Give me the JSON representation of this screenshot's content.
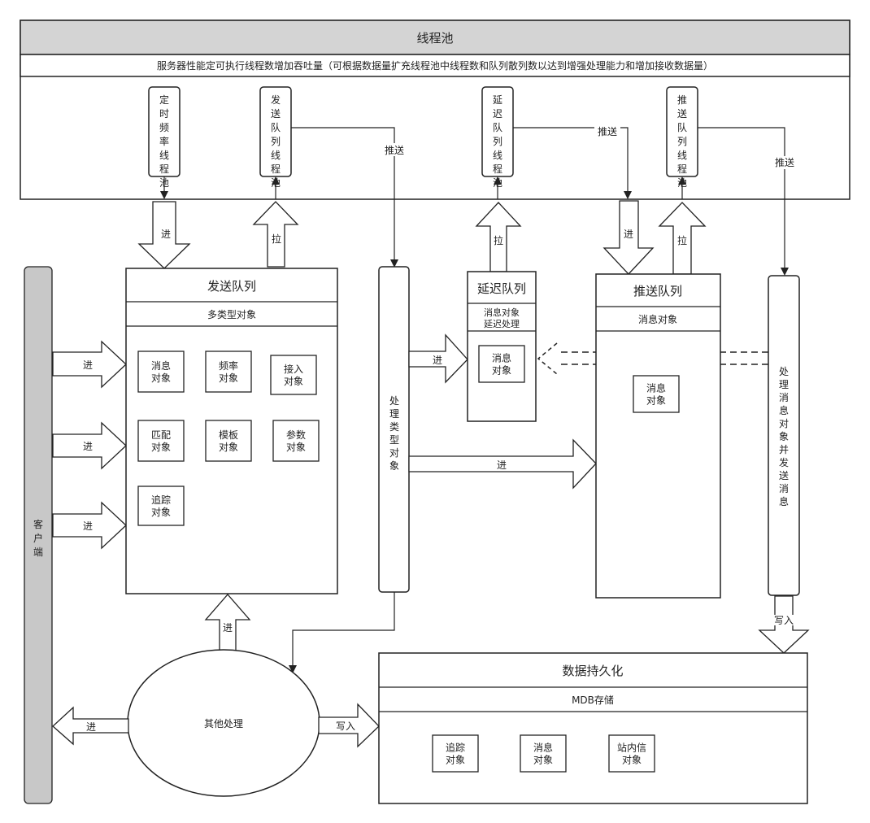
{
  "thread_pool": {
    "title": "线程池",
    "subtitle": "服务器性能定可执行线程数增加吞吐量（可根据数据量扩充线程池中线程数和队列散列数以达到增强处理能力和增加接收数据量）",
    "workers": {
      "timer": "定时频率线程池",
      "send": "发送队列线程池",
      "delay": "延迟队列线程池",
      "push": "推送队列线程池"
    }
  },
  "labels": {
    "in": "进",
    "pull": "拉",
    "push": "推送",
    "write": "写入"
  },
  "client": {
    "label": "客户端"
  },
  "send_queue": {
    "title": "发送队列",
    "subtitle": "多类型对象",
    "objects": [
      "消息对象",
      "频率对象",
      "接入对象",
      "匹配对象",
      "模板对象",
      "参数对象",
      "追踪对象"
    ]
  },
  "process_type": {
    "label": "处理类型对象"
  },
  "delay_queue": {
    "title": "延迟队列",
    "subtitle_1": "消息对象",
    "subtitle_2": "延迟处理",
    "object": "消息对象"
  },
  "push_queue": {
    "title": "推送队列",
    "subtitle": "消息对象",
    "object": "消息对象"
  },
  "process_send": {
    "label": "处理消息对象并发送消息"
  },
  "other_processing": {
    "label": "其他处理"
  },
  "persistence": {
    "title": "数据持久化",
    "subtitle": "MDB存储",
    "objects": [
      "追踪对象",
      "消息对象",
      "站内信对象"
    ]
  }
}
